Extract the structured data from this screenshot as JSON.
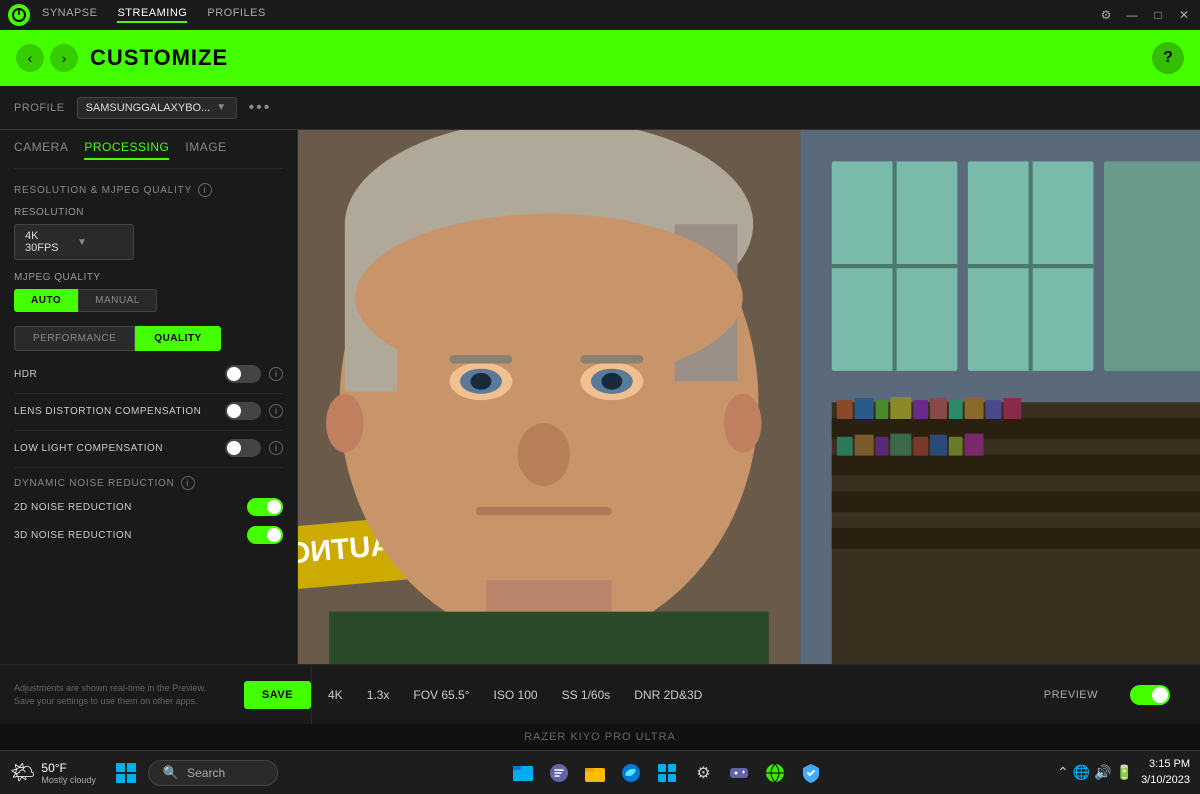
{
  "titlebar": {
    "nav": [
      {
        "id": "synapse",
        "label": "SYNAPSE",
        "active": false
      },
      {
        "id": "streaming",
        "label": "STREAMING",
        "active": true
      },
      {
        "id": "profiles",
        "label": "PROFILES",
        "active": false
      }
    ],
    "controls": [
      "⚙",
      "—",
      "□",
      "✕"
    ]
  },
  "header": {
    "title": "CUSTOMIZE",
    "help_label": "?"
  },
  "profile": {
    "label": "PROFILE",
    "value": "SAMSUNGGALAXYBO...",
    "more_icon": "•••"
  },
  "tabs": {
    "items": [
      {
        "id": "camera",
        "label": "CAMERA",
        "active": false
      },
      {
        "id": "processing",
        "label": "PROCESSING",
        "active": true
      },
      {
        "id": "image",
        "label": "IMAGE",
        "active": false
      }
    ]
  },
  "sections": {
    "resolution_mjpeg": {
      "label": "RESOLUTION & MJPEG QUALITY",
      "resolution_label": "RESOLUTION",
      "resolution_value": "4K 30FPS",
      "mjpeg_label": "MJPEG QUALITY",
      "auto_label": "AUTO",
      "manual_label": "MANUAL",
      "auto_active": true,
      "manual_active": false
    },
    "performance": {
      "performance_label": "PERFORMANCE",
      "quality_label": "QUALITY",
      "quality_active": true,
      "performance_active": false
    },
    "hdr": {
      "label": "HDR",
      "enabled": false
    },
    "lens_distortion": {
      "label": "LENS DISTORTION COMPENSATION",
      "enabled": false
    },
    "low_light": {
      "label": "LOW LIGHT COMPENSATION",
      "enabled": false
    },
    "dynamic_noise": {
      "label": "DYNAMIC NOISE REDUCTION",
      "noise_2d_label": "2D NOISE REDUCTION",
      "noise_2d_enabled": true,
      "noise_3d_label": "3D NOISE REDUCTION",
      "noise_3d_enabled": true
    }
  },
  "bottom_bar": {
    "tip_line1": "Adjustments are shown real-time in the Preview.",
    "tip_line2": "Save your settings to use them on other apps.",
    "save_label": "SAVE",
    "stats": [
      {
        "id": "res",
        "value": "4K"
      },
      {
        "id": "zoom",
        "value": "1.3x"
      },
      {
        "id": "fov",
        "value": "FOV 65.5°"
      },
      {
        "id": "iso",
        "value": "ISO 100"
      },
      {
        "id": "ss",
        "value": "SS 1/60s"
      },
      {
        "id": "dnr",
        "value": "DNR 2D&3D"
      }
    ],
    "preview_label": "PREVIEW"
  },
  "camera_name": "RAZER KIYO PRO ULTRA",
  "taskbar": {
    "temperature": "50°F",
    "condition": "Mostly cloudy",
    "search_placeholder": "Search",
    "apps": [
      "📁",
      "💬",
      "📂",
      "🌐",
      "🗂",
      "🔧",
      "🎮",
      "🌍",
      "🛡"
    ],
    "time": "3:15 PM",
    "date": "3/10/2023"
  }
}
